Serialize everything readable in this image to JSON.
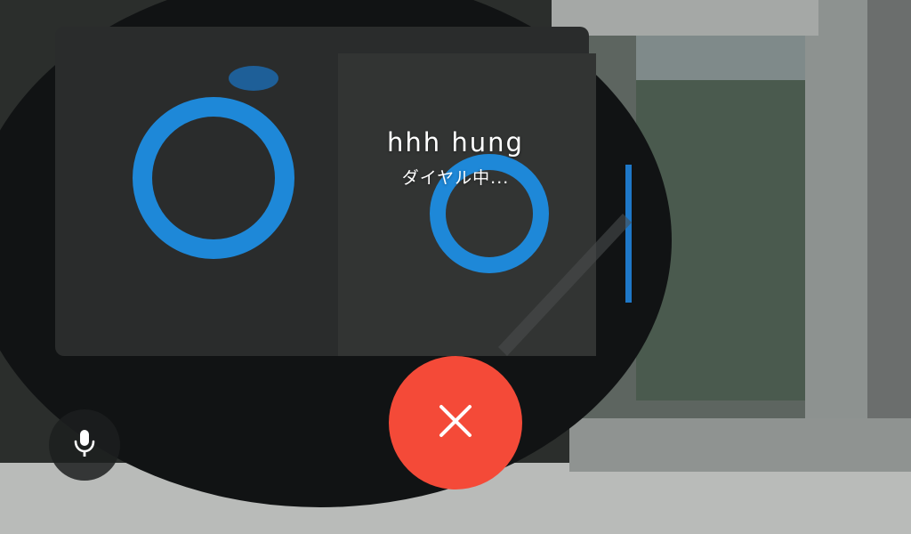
{
  "call": {
    "caller_name": "hhh hung",
    "status": "ダイヤル中..."
  },
  "controls": {
    "mic_icon": "microphone-icon",
    "end_call_icon": "close-icon",
    "end_call_color": "#f44a38",
    "mic_button_color": "#1c1e1e"
  },
  "background": {
    "description_color_accent": "#1e88d8"
  }
}
